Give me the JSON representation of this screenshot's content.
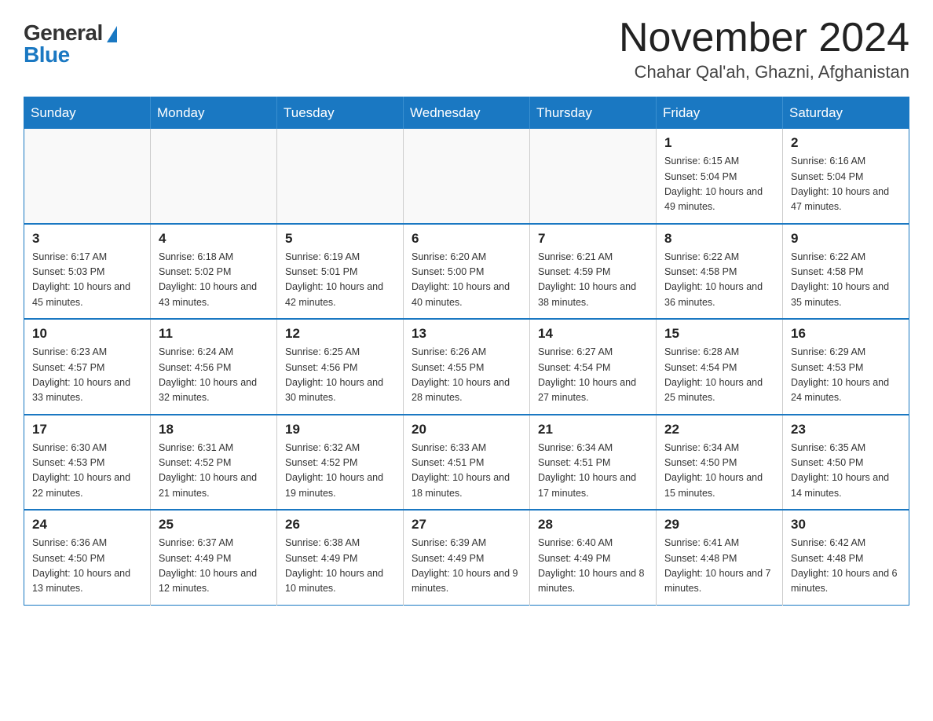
{
  "logo": {
    "general": "General",
    "blue": "Blue"
  },
  "header": {
    "month_year": "November 2024",
    "location": "Chahar Qal'ah, Ghazni, Afghanistan"
  },
  "weekdays": [
    "Sunday",
    "Monday",
    "Tuesday",
    "Wednesday",
    "Thursday",
    "Friday",
    "Saturday"
  ],
  "weeks": [
    [
      {
        "day": "",
        "info": ""
      },
      {
        "day": "",
        "info": ""
      },
      {
        "day": "",
        "info": ""
      },
      {
        "day": "",
        "info": ""
      },
      {
        "day": "",
        "info": ""
      },
      {
        "day": "1",
        "info": "Sunrise: 6:15 AM\nSunset: 5:04 PM\nDaylight: 10 hours and 49 minutes."
      },
      {
        "day": "2",
        "info": "Sunrise: 6:16 AM\nSunset: 5:04 PM\nDaylight: 10 hours and 47 minutes."
      }
    ],
    [
      {
        "day": "3",
        "info": "Sunrise: 6:17 AM\nSunset: 5:03 PM\nDaylight: 10 hours and 45 minutes."
      },
      {
        "day": "4",
        "info": "Sunrise: 6:18 AM\nSunset: 5:02 PM\nDaylight: 10 hours and 43 minutes."
      },
      {
        "day": "5",
        "info": "Sunrise: 6:19 AM\nSunset: 5:01 PM\nDaylight: 10 hours and 42 minutes."
      },
      {
        "day": "6",
        "info": "Sunrise: 6:20 AM\nSunset: 5:00 PM\nDaylight: 10 hours and 40 minutes."
      },
      {
        "day": "7",
        "info": "Sunrise: 6:21 AM\nSunset: 4:59 PM\nDaylight: 10 hours and 38 minutes."
      },
      {
        "day": "8",
        "info": "Sunrise: 6:22 AM\nSunset: 4:58 PM\nDaylight: 10 hours and 36 minutes."
      },
      {
        "day": "9",
        "info": "Sunrise: 6:22 AM\nSunset: 4:58 PM\nDaylight: 10 hours and 35 minutes."
      }
    ],
    [
      {
        "day": "10",
        "info": "Sunrise: 6:23 AM\nSunset: 4:57 PM\nDaylight: 10 hours and 33 minutes."
      },
      {
        "day": "11",
        "info": "Sunrise: 6:24 AM\nSunset: 4:56 PM\nDaylight: 10 hours and 32 minutes."
      },
      {
        "day": "12",
        "info": "Sunrise: 6:25 AM\nSunset: 4:56 PM\nDaylight: 10 hours and 30 minutes."
      },
      {
        "day": "13",
        "info": "Sunrise: 6:26 AM\nSunset: 4:55 PM\nDaylight: 10 hours and 28 minutes."
      },
      {
        "day": "14",
        "info": "Sunrise: 6:27 AM\nSunset: 4:54 PM\nDaylight: 10 hours and 27 minutes."
      },
      {
        "day": "15",
        "info": "Sunrise: 6:28 AM\nSunset: 4:54 PM\nDaylight: 10 hours and 25 minutes."
      },
      {
        "day": "16",
        "info": "Sunrise: 6:29 AM\nSunset: 4:53 PM\nDaylight: 10 hours and 24 minutes."
      }
    ],
    [
      {
        "day": "17",
        "info": "Sunrise: 6:30 AM\nSunset: 4:53 PM\nDaylight: 10 hours and 22 minutes."
      },
      {
        "day": "18",
        "info": "Sunrise: 6:31 AM\nSunset: 4:52 PM\nDaylight: 10 hours and 21 minutes."
      },
      {
        "day": "19",
        "info": "Sunrise: 6:32 AM\nSunset: 4:52 PM\nDaylight: 10 hours and 19 minutes."
      },
      {
        "day": "20",
        "info": "Sunrise: 6:33 AM\nSunset: 4:51 PM\nDaylight: 10 hours and 18 minutes."
      },
      {
        "day": "21",
        "info": "Sunrise: 6:34 AM\nSunset: 4:51 PM\nDaylight: 10 hours and 17 minutes."
      },
      {
        "day": "22",
        "info": "Sunrise: 6:34 AM\nSunset: 4:50 PM\nDaylight: 10 hours and 15 minutes."
      },
      {
        "day": "23",
        "info": "Sunrise: 6:35 AM\nSunset: 4:50 PM\nDaylight: 10 hours and 14 minutes."
      }
    ],
    [
      {
        "day": "24",
        "info": "Sunrise: 6:36 AM\nSunset: 4:50 PM\nDaylight: 10 hours and 13 minutes."
      },
      {
        "day": "25",
        "info": "Sunrise: 6:37 AM\nSunset: 4:49 PM\nDaylight: 10 hours and 12 minutes."
      },
      {
        "day": "26",
        "info": "Sunrise: 6:38 AM\nSunset: 4:49 PM\nDaylight: 10 hours and 10 minutes."
      },
      {
        "day": "27",
        "info": "Sunrise: 6:39 AM\nSunset: 4:49 PM\nDaylight: 10 hours and 9 minutes."
      },
      {
        "day": "28",
        "info": "Sunrise: 6:40 AM\nSunset: 4:49 PM\nDaylight: 10 hours and 8 minutes."
      },
      {
        "day": "29",
        "info": "Sunrise: 6:41 AM\nSunset: 4:48 PM\nDaylight: 10 hours and 7 minutes."
      },
      {
        "day": "30",
        "info": "Sunrise: 6:42 AM\nSunset: 4:48 PM\nDaylight: 10 hours and 6 minutes."
      }
    ]
  ]
}
